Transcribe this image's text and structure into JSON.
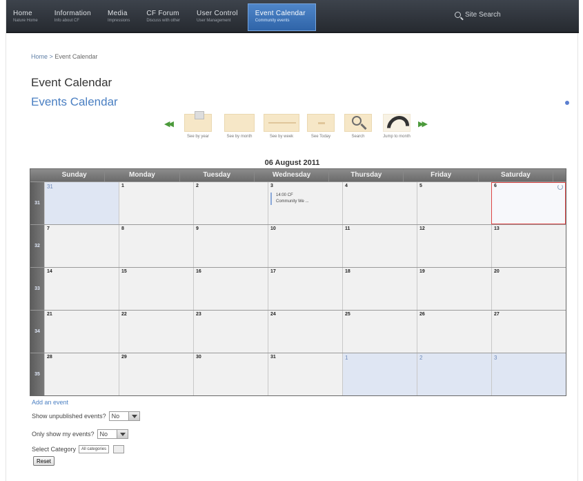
{
  "nav": {
    "items": [
      {
        "title": "Home",
        "sub": "Nature Home"
      },
      {
        "title": "Information",
        "sub": "Info about CF"
      },
      {
        "title": "Media",
        "sub": "Impressions"
      },
      {
        "title": "CF Forum",
        "sub": "Discuss with other"
      },
      {
        "title": "User Control",
        "sub": "User Management"
      },
      {
        "title": "Event Calendar",
        "sub": "Community events"
      }
    ],
    "search_placeholder": "Site Search"
  },
  "breadcrumb": {
    "home": "Home",
    "sep": ">",
    "current": "Event Calendar"
  },
  "page_title": "Event Calendar",
  "sub_title": "Events Calendar",
  "toolbar": {
    "buttons": [
      {
        "label": "See by year"
      },
      {
        "label": "See by month"
      },
      {
        "label": "See by week"
      },
      {
        "label": "See Today"
      },
      {
        "label": "Search"
      },
      {
        "label": "Jump to month"
      }
    ]
  },
  "calendar": {
    "current_date": "06 August 2011",
    "weekdays": [
      "Sunday",
      "Monday",
      "Tuesday",
      "Wednesday",
      "Thursday",
      "Friday",
      "Saturday"
    ],
    "weeks": [
      {
        "number": "31",
        "days": [
          {
            "num": "31"
          },
          {
            "num": "1"
          },
          {
            "num": "2"
          },
          {
            "num": "3",
            "event_time": "14:00 CF",
            "event_title": "Community We ..."
          },
          {
            "num": "4"
          },
          {
            "num": "5"
          },
          {
            "num": "6"
          }
        ]
      },
      {
        "number": "32",
        "days": [
          {
            "num": "7"
          },
          {
            "num": "8"
          },
          {
            "num": "9"
          },
          {
            "num": "10"
          },
          {
            "num": "11"
          },
          {
            "num": "12"
          },
          {
            "num": "13"
          }
        ]
      },
      {
        "number": "33",
        "days": [
          {
            "num": "14"
          },
          {
            "num": "15"
          },
          {
            "num": "16"
          },
          {
            "num": "17"
          },
          {
            "num": "18"
          },
          {
            "num": "19"
          },
          {
            "num": "20"
          }
        ]
      },
      {
        "number": "34",
        "days": [
          {
            "num": "21"
          },
          {
            "num": "22"
          },
          {
            "num": "23"
          },
          {
            "num": "24"
          },
          {
            "num": "25"
          },
          {
            "num": "26"
          },
          {
            "num": "27"
          }
        ]
      },
      {
        "number": "35",
        "days": [
          {
            "num": "28"
          },
          {
            "num": "29"
          },
          {
            "num": "30"
          },
          {
            "num": "31"
          },
          {
            "num": "1"
          },
          {
            "num": "2"
          },
          {
            "num": "3"
          }
        ]
      }
    ]
  },
  "options": {
    "add_event": "Add an event",
    "show_unpublished_label": "Show unpublished events?",
    "show_unpublished_value": "No",
    "only_mine_label": "Only show my events?",
    "only_mine_value": "No",
    "category_label": "Select Category",
    "category_value": "All categories",
    "reset_label": "Reset"
  }
}
